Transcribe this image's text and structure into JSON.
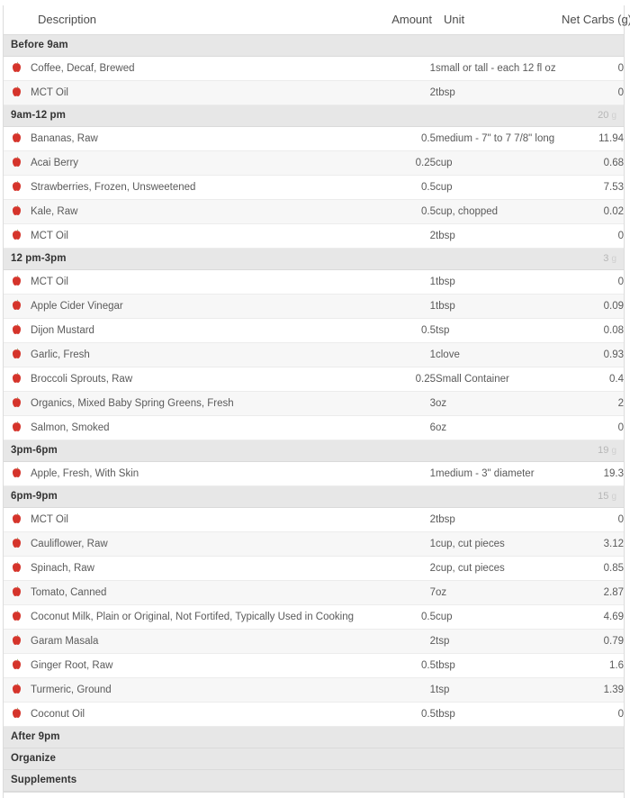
{
  "table": {
    "columns": {
      "description": "Description",
      "amount": "Amount",
      "unit": "Unit",
      "net_carbs": "Net Carbs (g)"
    },
    "icon_name": "apple-icon",
    "accent_color": "#d5342b",
    "section_header_bg": "#e7e7e7",
    "row_alt_bg": "#f7f7f7",
    "sections": [
      {
        "label": "Before 9am",
        "total": "",
        "items": [
          {
            "description": "Coffee, Decaf, Brewed",
            "amount": "1",
            "unit": "small or tall - each 12 fl oz",
            "net_carbs": "0"
          },
          {
            "description": "MCT Oil",
            "amount": "2",
            "unit": "tbsp",
            "net_carbs": "0"
          }
        ]
      },
      {
        "label": "9am-12 pm",
        "total": "20",
        "total_unit": "g",
        "items": [
          {
            "description": "Bananas, Raw",
            "amount": "0.5",
            "unit": "medium - 7\" to 7 7/8\" long",
            "net_carbs": "11.94"
          },
          {
            "description": "Acai Berry",
            "amount": "0.25",
            "unit": "cup",
            "net_carbs": "0.68"
          },
          {
            "description": "Strawberries, Frozen, Unsweetened",
            "amount": "0.5",
            "unit": "cup",
            "net_carbs": "7.53"
          },
          {
            "description": "Kale, Raw",
            "amount": "0.5",
            "unit": "cup, chopped",
            "net_carbs": "0.02"
          },
          {
            "description": "MCT Oil",
            "amount": "2",
            "unit": "tbsp",
            "net_carbs": "0"
          }
        ]
      },
      {
        "label": "12 pm-3pm",
        "total": "3",
        "total_unit": "g",
        "items": [
          {
            "description": "MCT Oil",
            "amount": "1",
            "unit": "tbsp",
            "net_carbs": "0"
          },
          {
            "description": "Apple Cider Vinegar",
            "amount": "1",
            "unit": "tbsp",
            "net_carbs": "0.09"
          },
          {
            "description": "Dijon Mustard",
            "amount": "0.5",
            "unit": "tsp",
            "net_carbs": "0.08"
          },
          {
            "description": "Garlic, Fresh",
            "amount": "1",
            "unit": "clove",
            "net_carbs": "0.93"
          },
          {
            "description": "Broccoli Sprouts, Raw",
            "amount": "0.25",
            "unit": "Small Container",
            "net_carbs": "0.4"
          },
          {
            "description": "Organics, Mixed Baby Spring Greens, Fresh",
            "amount": "3",
            "unit": "oz",
            "net_carbs": "2"
          },
          {
            "description": "Salmon, Smoked",
            "amount": "6",
            "unit": "oz",
            "net_carbs": "0"
          }
        ]
      },
      {
        "label": "3pm-6pm",
        "total": "19",
        "total_unit": "g",
        "items": [
          {
            "description": "Apple, Fresh, With Skin",
            "amount": "1",
            "unit": "medium - 3\" diameter",
            "net_carbs": "19.3"
          }
        ]
      },
      {
        "label": "6pm-9pm",
        "total": "15",
        "total_unit": "g",
        "items": [
          {
            "description": "MCT Oil",
            "amount": "2",
            "unit": "tbsp",
            "net_carbs": "0"
          },
          {
            "description": "Cauliflower, Raw",
            "amount": "1",
            "unit": "cup, cut pieces",
            "net_carbs": "3.12"
          },
          {
            "description": "Spinach, Raw",
            "amount": "2",
            "unit": "cup, cut pieces",
            "net_carbs": "0.85"
          },
          {
            "description": "Tomato, Canned",
            "amount": "7",
            "unit": "oz",
            "net_carbs": "2.87"
          },
          {
            "description": "Coconut Milk, Plain or Original, Not Fortifed, Typically Used in Cooking",
            "amount": "0.5",
            "unit": "cup",
            "net_carbs": "4.69"
          },
          {
            "description": "Garam Masala",
            "amount": "2",
            "unit": "tsp",
            "net_carbs": "0.79"
          },
          {
            "description": "Ginger Root, Raw",
            "amount": "0.5",
            "unit": "tbsp",
            "net_carbs": "1.6"
          },
          {
            "description": "Turmeric, Ground",
            "amount": "1",
            "unit": "tsp",
            "net_carbs": "1.39"
          },
          {
            "description": "Coconut Oil",
            "amount": "0.5",
            "unit": "tbsp",
            "net_carbs": "0"
          }
        ]
      },
      {
        "label": "After 9pm",
        "total": "",
        "items": []
      },
      {
        "label": "Organize",
        "total": "",
        "items": []
      },
      {
        "label": "Supplements",
        "total": "",
        "items": []
      }
    ]
  }
}
